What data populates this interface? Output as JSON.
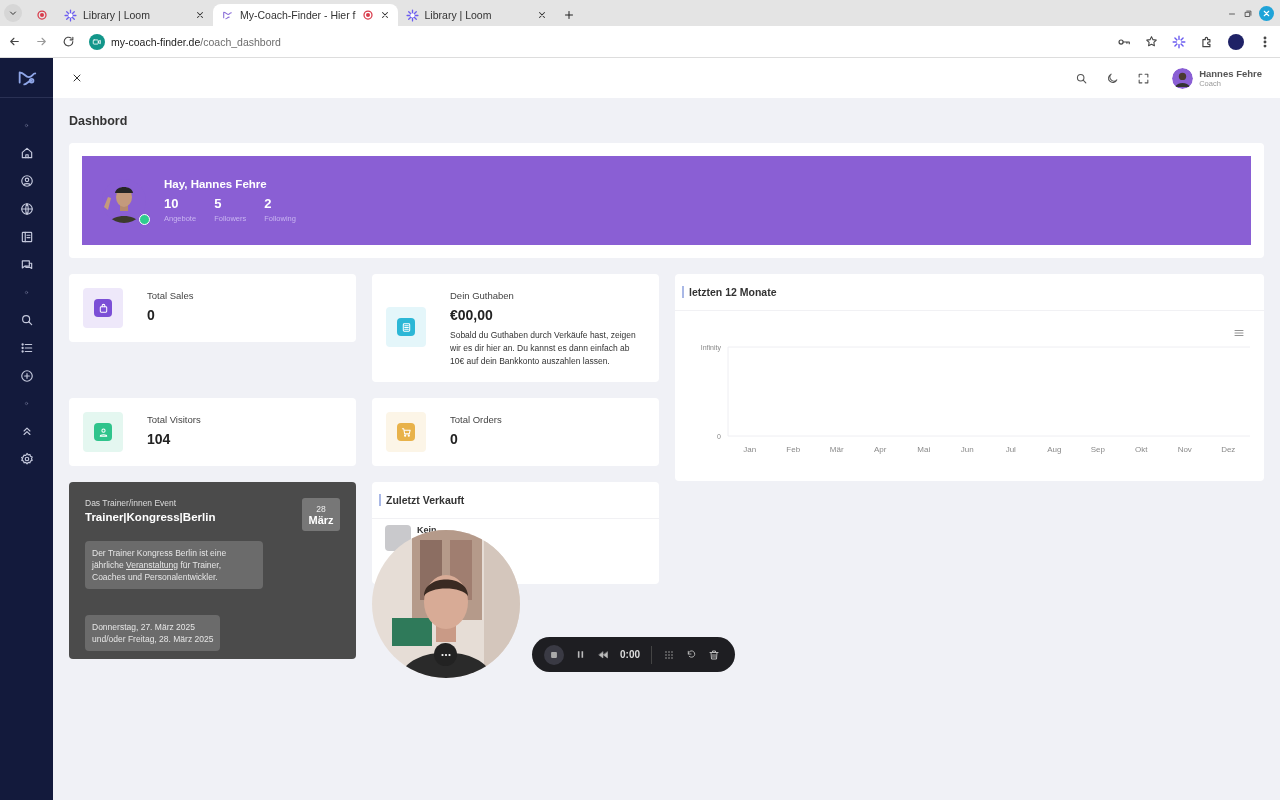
{
  "browser": {
    "tabs": [
      {
        "kind": "pinned",
        "recording": true,
        "selected": false
      },
      {
        "kind": "loom",
        "label": "Library | Loom",
        "recording": false,
        "selected": false
      },
      {
        "kind": "site",
        "label": "My-Coach-Finder - Hier f",
        "recording": true,
        "selected": true
      },
      {
        "kind": "loom",
        "label": "Library | Loom",
        "recording": false,
        "selected": false
      }
    ],
    "url_host": "my-coach-finder.de",
    "url_path": "/coach_dashbord"
  },
  "header": {
    "user_name": "Hannes Fehre",
    "user_role": "Coach"
  },
  "page_title": "Dashbord",
  "welcome": {
    "greeting": "Hay, Hannes Fehre",
    "online": true,
    "stats": [
      {
        "value": "10",
        "label": "Angebote"
      },
      {
        "value": "5",
        "label": "Followers"
      },
      {
        "value": "2",
        "label": "Following"
      }
    ]
  },
  "cards": [
    {
      "kind": "bag",
      "title": "Total Sales",
      "value": "0",
      "color": "#7b4fd6"
    },
    {
      "kind": "register",
      "title": "Dein Guthaben",
      "value": "€00,00",
      "note": "Sobald du Guthaben durch Verkäufe hast, zeigen wir es dir hier an. Du kannst es dann einfach ab 10€ auf dein Bankkonto auszahlen lassen.",
      "color": "#2cb7d6"
    },
    {
      "kind": "person",
      "title": "Total Visitors",
      "value": "104",
      "color": "#2fc48c"
    },
    {
      "kind": "cart",
      "title": "Total Orders",
      "value": "0",
      "color": "#e8b24a"
    }
  ],
  "sales_chart": {
    "title": "letzten 12 Monate",
    "y_labels": [
      "Infinity",
      "0"
    ],
    "x_labels": [
      "Jan",
      "Feb",
      "Mär",
      "Apr",
      "Mai",
      "Jun",
      "Jul",
      "Aug",
      "Sep",
      "Okt",
      "Nov",
      "Dez"
    ]
  },
  "event": {
    "eyebrow": "Das Trainer/innen Event",
    "title": "Trainer|Kongress|Berlin",
    "day": "28",
    "month": "März",
    "description": [
      {
        "text": "Der Trainer Kongress Berlin ist eine jährliche ",
        "link": false
      },
      {
        "text": "Veranstaltung",
        "link": true
      },
      {
        "text": " für Trainer, Coaches und Personalentwickler.",
        "link": false
      }
    ],
    "dates": [
      "Donnerstag, 27. März 2025",
      "und/oder Freitag, 28. März 2025"
    ]
  },
  "recent_sales": {
    "title": "Zuletzt Verkauft",
    "items": [
      {
        "text": "Kein"
      }
    ]
  },
  "recorder": {
    "time": "0:00"
  }
}
